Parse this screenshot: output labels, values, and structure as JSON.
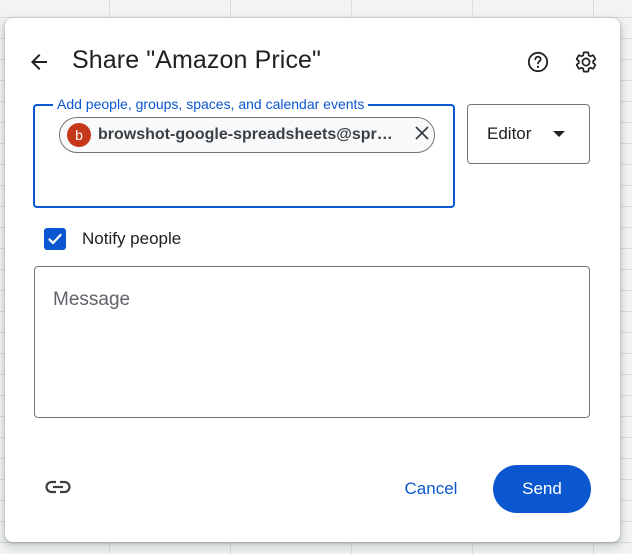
{
  "dialog": {
    "title": "Share \"Amazon Price\"",
    "back_icon": "arrow-back-icon",
    "help_icon": "help-circle-icon",
    "settings_icon": "gear-icon"
  },
  "add_people": {
    "label": "Add people, groups, spaces, and calendar events",
    "chips": [
      {
        "avatar_letter": "b",
        "text": "browshot-google-spreadsheets@spr…",
        "remove_icon": "close-icon"
      }
    ]
  },
  "role": {
    "selected": "Editor",
    "caret_icon": "caret-down-icon"
  },
  "notify": {
    "label": "Notify people",
    "checked": true
  },
  "message": {
    "placeholder": "Message"
  },
  "footer": {
    "link_icon": "link-icon",
    "cancel_label": "Cancel",
    "send_label": "Send"
  },
  "colors": {
    "accent": "#0b57d0",
    "avatar": "#c5391a",
    "text": "#202124"
  }
}
